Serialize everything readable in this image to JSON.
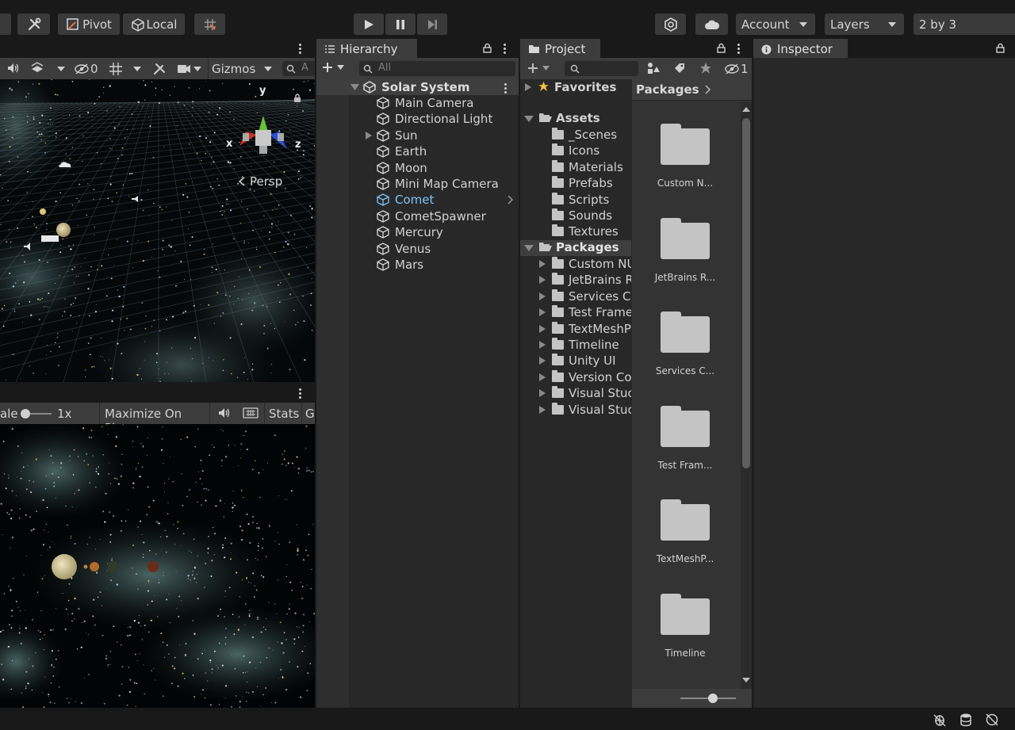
{
  "toolbar": {
    "pivot_label": "Pivot",
    "local_label": "Local",
    "account_label": "Account",
    "layers_label": "Layers",
    "layout_label": "2 by 3"
  },
  "scene": {
    "gizmos_label": "Gizmos",
    "hidden_count": "0",
    "search_placeholder": "A",
    "axis_x": "x",
    "axis_y": "y",
    "axis_z": "z",
    "persp_label": "Persp"
  },
  "game": {
    "scale_label": "ale",
    "scale_value": "1x",
    "maximize_label": "Maximize On Play",
    "stats_label": "Stats",
    "gizmos_label": "G"
  },
  "hierarchy": {
    "tab_label": "Hierarchy",
    "search_placeholder": "All",
    "scene_name": "Solar System",
    "items": [
      {
        "label": "Main Camera"
      },
      {
        "label": "Directional Light"
      },
      {
        "label": "Sun"
      },
      {
        "label": "Earth"
      },
      {
        "label": "Moon"
      },
      {
        "label": "Mini Map Camera"
      },
      {
        "label": "Comet"
      },
      {
        "label": "CometSpawner"
      },
      {
        "label": "Mercury"
      },
      {
        "label": "Venus"
      },
      {
        "label": "Mars"
      }
    ]
  },
  "project": {
    "tab_label": "Project",
    "hidden_count": "1",
    "favorites_label": "Favorites",
    "assets_label": "Assets",
    "asset_folders": [
      "_Scenes",
      "Icons",
      "Materials",
      "Prefabs",
      "Scripts",
      "Sounds",
      "Textures"
    ],
    "packages_label": "Packages",
    "package_folders": [
      "Custom NU",
      "JetBrains R",
      "Services C",
      "Test Frame",
      "TextMeshP",
      "Timeline",
      "Unity UI",
      "Version Co",
      "Visual Stuc",
      "Visual Stuc"
    ],
    "breadcrumb": "Packages",
    "grid_items": [
      "Custom N...",
      "JetBrains R...",
      "Services C...",
      "Test Fram...",
      "TextMeshP...",
      "Timeline"
    ]
  },
  "inspector": {
    "tab_label": "Inspector"
  },
  "colors": {
    "selected_text": "#7fc3f8",
    "panel_bg": "#282828",
    "toolbar_bg": "#191919"
  }
}
